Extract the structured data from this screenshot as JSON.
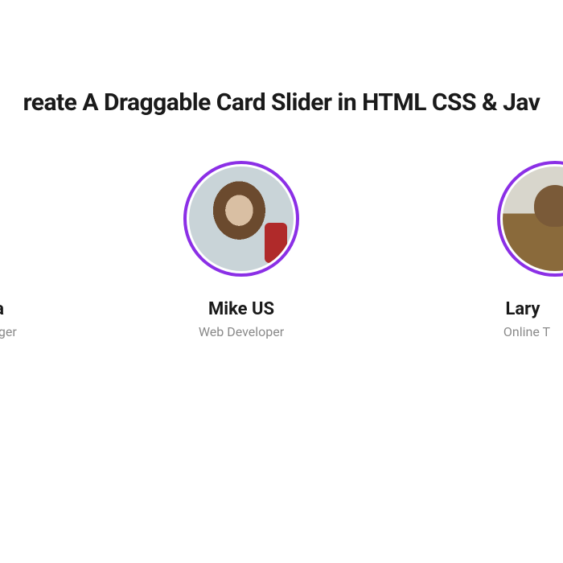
{
  "title": "reate A Draggable Card Slider in HTML CSS & Jav",
  "cards": [
    {
      "name": "dia",
      "role": "ager",
      "avatar_icon": "avatar-1"
    },
    {
      "name": "Mike US",
      "role": "Web Developer",
      "avatar_icon": "avatar-2"
    },
    {
      "name": "Lary",
      "role": "Online T",
      "avatar_icon": "avatar-3"
    }
  ],
  "accent_color": "#8B2FE6"
}
